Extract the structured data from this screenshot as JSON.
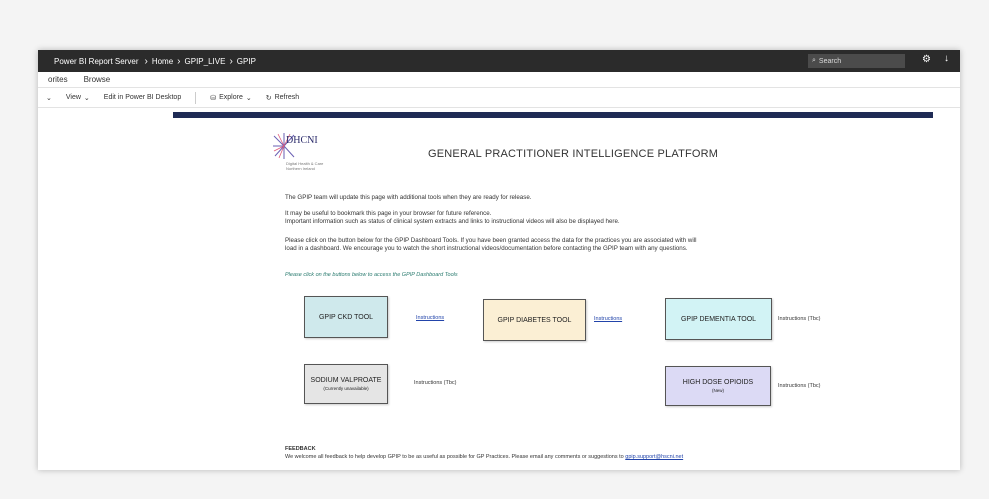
{
  "topbar": {
    "brand": "Power BI Report Server",
    "crumbs": [
      "Home",
      "GPIP_LIVE",
      "GPIP"
    ],
    "search_placeholder": "Search"
  },
  "nav": {
    "favorites": "orites",
    "browse": "Browse"
  },
  "toolbar": {
    "view": "View",
    "edit": "Edit in Power BI Desktop",
    "explore": "Explore",
    "refresh": "Refresh"
  },
  "logo": {
    "name": "DHCNI",
    "sub1": "Digital Health & Care",
    "sub2": "Northern Ireland"
  },
  "page_title": "GENERAL PRACTITIONER INTELLIGENCE PLATFORM",
  "paragraphs": {
    "p1": "The GPIP team will update this page with additional tools when they are ready for release.",
    "p2a": "It may be useful to bookmark this page in your browser for future reference.",
    "p2b": "Important information such as status of clinical system extracts and links to instructional videos will also be displayed here.",
    "p3a": "Please click on the button below for the GPIP Dashboard Tools. If you have been granted access the data for the practices you are associated with will",
    "p3b": "load in a dashboard. We encourage you to watch the short instructional videos/documentation before contacting the GPIP team with any questions."
  },
  "link_note": "Please click on the buttons below to access the GPIP Dashboard Tools",
  "tools": {
    "ckd": {
      "label": "GPIP CKD TOOL",
      "instr": "Instructions"
    },
    "diabetes": {
      "label": "GPIP DIABETES TOOL",
      "instr": "Instructions"
    },
    "dementia": {
      "label": "GPIP DEMENTIA TOOL",
      "instr": "Instructions (Tbc)"
    },
    "valproate": {
      "label": "SODIUM VALPROATE",
      "note": "(Currently unavailable)",
      "instr": "Instructions (Tbc)"
    },
    "opioids": {
      "label": "HIGH DOSE OPIOIDS",
      "note": "(New)",
      "instr": "Instructions (Tbc)"
    }
  },
  "feedback": {
    "heading": "FEEDBACK",
    "text": "We welcome all feedback to help develop GPIP to be as useful as possible for GP Practices. Please email any comments or suggestions to",
    "email": "gpip.support@hscni.net"
  },
  "colors": {
    "ckd_bg": "#cfe9ec",
    "diabetes_bg": "#fbefd4",
    "dementia_bg": "#d2f3f5",
    "valproate_bg": "#e5e5e5",
    "opioids_bg": "#dcdaf5",
    "navy": "#1f2b55"
  }
}
